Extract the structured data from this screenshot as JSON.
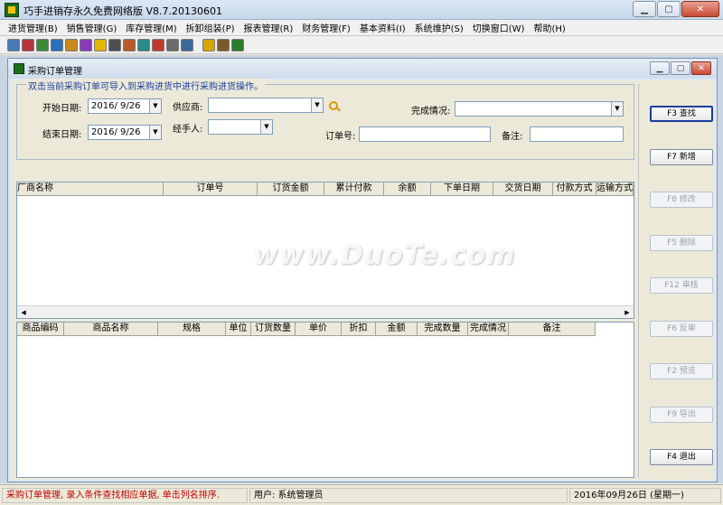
{
  "app": {
    "title": "巧手进销存永久免费网络版 V8.7.20130601"
  },
  "menu": [
    "进货管理(B)",
    "销售管理(G)",
    "库存管理(M)",
    "拆卸组装(P)",
    "报表管理(R)",
    "财务管理(F)",
    "基本资料(I)",
    "系统维护(S)",
    "切换窗口(W)",
    "帮助(H)"
  ],
  "toolbar_icons": [
    {
      "name": "purchase-icon",
      "color": "#4a7ab8"
    },
    {
      "name": "return-icon",
      "color": "#b8343a"
    },
    {
      "name": "sale-icon",
      "color": "#3a8a3a"
    },
    {
      "name": "transfer-icon",
      "color": "#2c6fbf"
    },
    {
      "name": "stock-icon",
      "color": "#c78a1d"
    },
    {
      "name": "report-icon",
      "color": "#8a3ab8"
    },
    {
      "name": "lightning-icon",
      "color": "#e3b400"
    },
    {
      "name": "grid-icon",
      "color": "#505050"
    },
    {
      "name": "users-icon",
      "color": "#b85a2c"
    },
    {
      "name": "chart-icon",
      "color": "#2c8a8a"
    },
    {
      "name": "calendar-icon",
      "color": "#c0392b"
    },
    {
      "name": "settings-icon",
      "color": "#6a6a6a"
    },
    {
      "name": "table-icon",
      "color": "#3a6a9a"
    },
    {
      "name": "help-icon",
      "color": "#d4a800"
    },
    {
      "name": "tools-icon",
      "color": "#7a5a2c"
    },
    {
      "name": "exit-icon",
      "color": "#2c7a2c"
    }
  ],
  "child": {
    "title": "采购订单管理"
  },
  "criteria": {
    "legend": "双击当前采购订单可导入到采购进货中进行采购进货操作。",
    "start_date_label": "开始日期:",
    "start_date": "2016/ 9/26",
    "end_date_label": "结束日期:",
    "end_date": "2016/ 9/26",
    "supplier_label": "供应商:",
    "supplier": "",
    "handler_label": "经手人:",
    "handler": "",
    "status_label": "完成情况:",
    "status": "",
    "order_no_label": "订单号:",
    "order_no": "",
    "remark_label": "备注:",
    "remark": ""
  },
  "grid_orders": {
    "columns": [
      "厂商名称",
      "订单号",
      "订货金额",
      "累计付款",
      "余额",
      "下单日期",
      "交货日期",
      "付款方式",
      "运输方式"
    ],
    "rows": []
  },
  "grid_items": {
    "columns": [
      "商品编码",
      "商品名称",
      "规格",
      "单位",
      "订货数量",
      "单价",
      "折扣",
      "金额",
      "完成数量",
      "完成情况",
      "备注"
    ],
    "rows": []
  },
  "buttons": [
    {
      "label": "F3 查找",
      "enabled": true
    },
    {
      "label": "F7 新增",
      "enabled": true
    },
    {
      "label": "F8 修改",
      "enabled": false
    },
    {
      "label": "F5 删除",
      "enabled": false
    },
    {
      "label": "F12 审核",
      "enabled": false
    },
    {
      "label": "F6 反审",
      "enabled": false
    },
    {
      "label": "F2 预览",
      "enabled": false
    },
    {
      "label": "F9 导出",
      "enabled": false
    },
    {
      "label": "F4 退出",
      "enabled": true
    }
  ],
  "status_bar": {
    "message": "采购订单管理, 录入条件查找相应单据, 单击列名排序.",
    "message_color": "#c00000",
    "user": "用户: 系统管理员",
    "date": "2016年09月26日 (星期一)"
  },
  "watermark": "www.DuoTe.com"
}
